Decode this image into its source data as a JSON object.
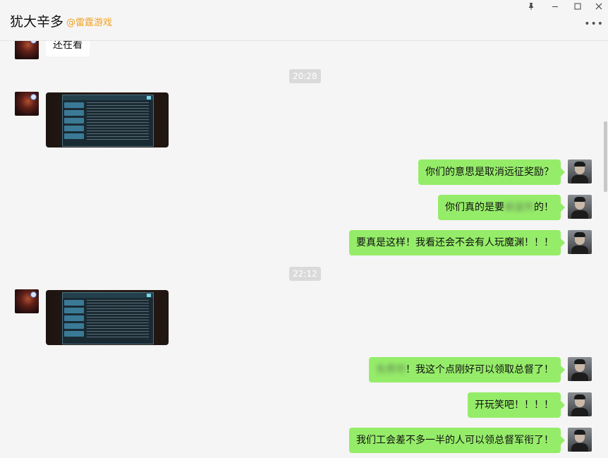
{
  "header": {
    "title": "犹大辛多",
    "subtitle": "@雷霆游戏",
    "pin_icon": "pin-icon",
    "minimize_icon": "minimize-icon",
    "maximize_icon": "maximize-icon",
    "close_icon": "close-icon",
    "more_icon": "more-icon"
  },
  "messages": {
    "m0": "还在看",
    "ts1": "20:28",
    "m1": "你们的意思是取消远征奖励？",
    "m2_a": "你们真的是要",
    "m2_blur": "被逼死",
    "m2_b": "的！",
    "m3": "要真是这样！我看还会不会有人玩魔渊！！！",
    "ts2": "22:12",
    "m4_blur": "免费吧",
    "m4_b": "！我这个点刚好可以领取总督了！",
    "m5": "开玩笑吧！！！！",
    "m6": "我们工会差不多一半的人可以领总督军衔了！"
  },
  "colors": {
    "outgoing_bubble": "#95ec69",
    "incoming_bubble": "#ffffff",
    "subtitle": "#f0a020",
    "timestamp_bg": "#dadada"
  }
}
